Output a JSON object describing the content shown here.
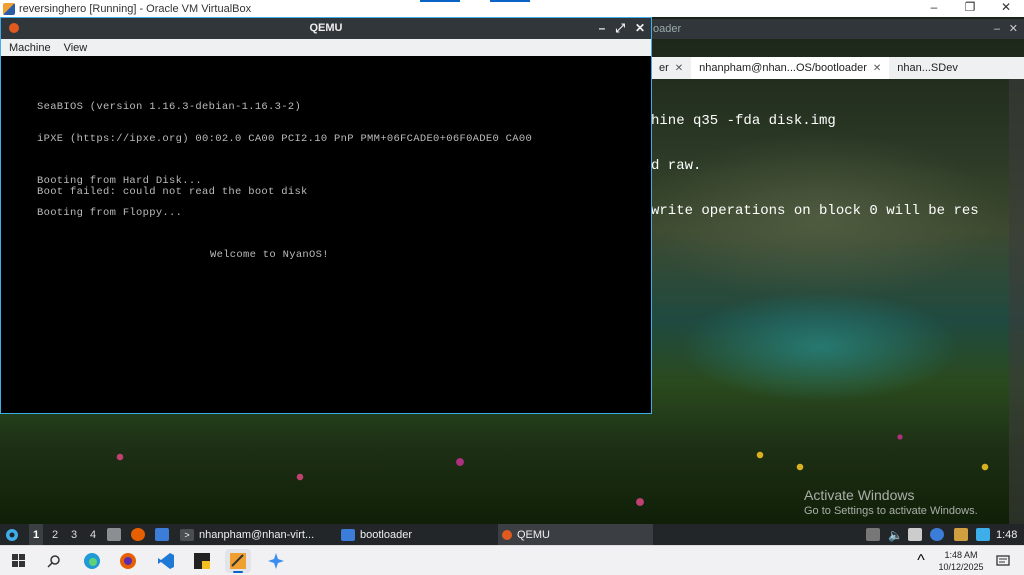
{
  "host_window": {
    "title": "reversinghero [Running] - Oracle VM VirtualBox",
    "minimize": "–",
    "maximize": "❐",
    "close": "✕"
  },
  "konsole": {
    "title_partial": "oader",
    "tabs": [
      {
        "label": "er"
      },
      {
        "label": "nhanpham@nhan...OS/bootloader"
      },
      {
        "label": "nhan...SDev"
      }
    ],
    "lines": [
      "hine q35 -fda disk.img",
      "d raw.",
      "write operations on block 0 will be res"
    ]
  },
  "qemu": {
    "title": "QEMU",
    "buttons": {
      "minimize": "–",
      "restore": "⤢",
      "close": "✕"
    },
    "menu": [
      "Machine",
      "View"
    ],
    "screen_lines": [
      "SeaBIOS (version 1.16.3-debian-1.16.3-2)",
      "iPXE (https://ipxe.org) 00:02.0 CA00 PCI2.10 PnP PMM+06FCADE0+06F0ADE0 CA00",
      "Booting from Hard Disk...",
      "Boot failed: could not read the boot disk",
      "Booting from Floppy...",
      "Welcome to NyanOS!"
    ]
  },
  "watermark": {
    "title": "Activate Windows",
    "subtitle": "Go to Settings to activate Windows."
  },
  "kde_panel": {
    "desktops": [
      "1",
      "2",
      "3",
      "4"
    ],
    "tasks": [
      {
        "label": "nhanpham@nhan-virt...",
        "icon": "terminal-icon"
      },
      {
        "label": "bootloader",
        "icon": "folder-icon"
      },
      {
        "label": "QEMU",
        "icon": "qemu-icon"
      }
    ],
    "clock": "1:48"
  },
  "windows_taskbar": {
    "time": "1:48 AM",
    "date": "10/12/2025",
    "tray_chevron": "^"
  },
  "colors": {
    "accent": "#3daee9",
    "host_accent": "#0a64c8",
    "qemu_icon": "#e05a20"
  }
}
